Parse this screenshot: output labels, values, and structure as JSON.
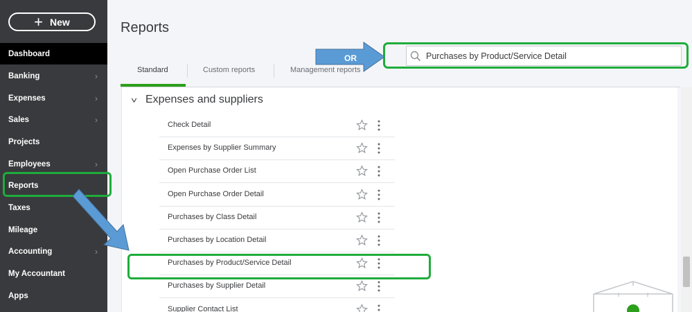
{
  "sidebar": {
    "new_button": {
      "label": "New",
      "icon": "plus-icon"
    },
    "items": [
      {
        "label": "Dashboard",
        "chevron": false,
        "active": true
      },
      {
        "label": "Banking",
        "chevron": true
      },
      {
        "label": "Expenses",
        "chevron": true
      },
      {
        "label": "Sales",
        "chevron": true
      },
      {
        "label": "Projects",
        "chevron": false
      },
      {
        "label": "Employees",
        "chevron": true
      },
      {
        "label": "Reports",
        "chevron": false
      },
      {
        "label": "Taxes",
        "chevron": false
      },
      {
        "label": "Mileage",
        "chevron": false
      },
      {
        "label": "Accounting",
        "chevron": true
      },
      {
        "label": "My Accountant",
        "chevron": false
      },
      {
        "label": "Apps",
        "chevron": false
      }
    ],
    "chevron_glyph": "›"
  },
  "header": {
    "title": "Reports",
    "tabs": [
      {
        "label": "Standard",
        "active": true
      },
      {
        "label": "Custom reports"
      },
      {
        "label": "Management reports"
      }
    ]
  },
  "search": {
    "value": "Purchases by Product/Service Detail",
    "icon": "search-icon"
  },
  "annotations": {
    "or_label": "OR",
    "highlight_color": "#1eac3b",
    "arrow_color": "#5b9bd5"
  },
  "section": {
    "title": "Expenses and suppliers",
    "collapse_glyph": "˅",
    "reports": [
      {
        "name": "Check Detail"
      },
      {
        "name": "Expenses by Supplier Summary"
      },
      {
        "name": "Open Purchase Order List"
      },
      {
        "name": "Open Purchase Order Detail"
      },
      {
        "name": "Purchases by Class Detail"
      },
      {
        "name": "Purchases by Location Detail"
      },
      {
        "name": "Purchases by Product/Service Detail",
        "highlighted": true
      },
      {
        "name": "Purchases by Supplier Detail"
      },
      {
        "name": "Supplier Contact List"
      }
    ]
  },
  "colors": {
    "sidebar_bg": "#393a3d",
    "active_nav_bg": "#000000",
    "accent_green": "#2ca01c"
  }
}
